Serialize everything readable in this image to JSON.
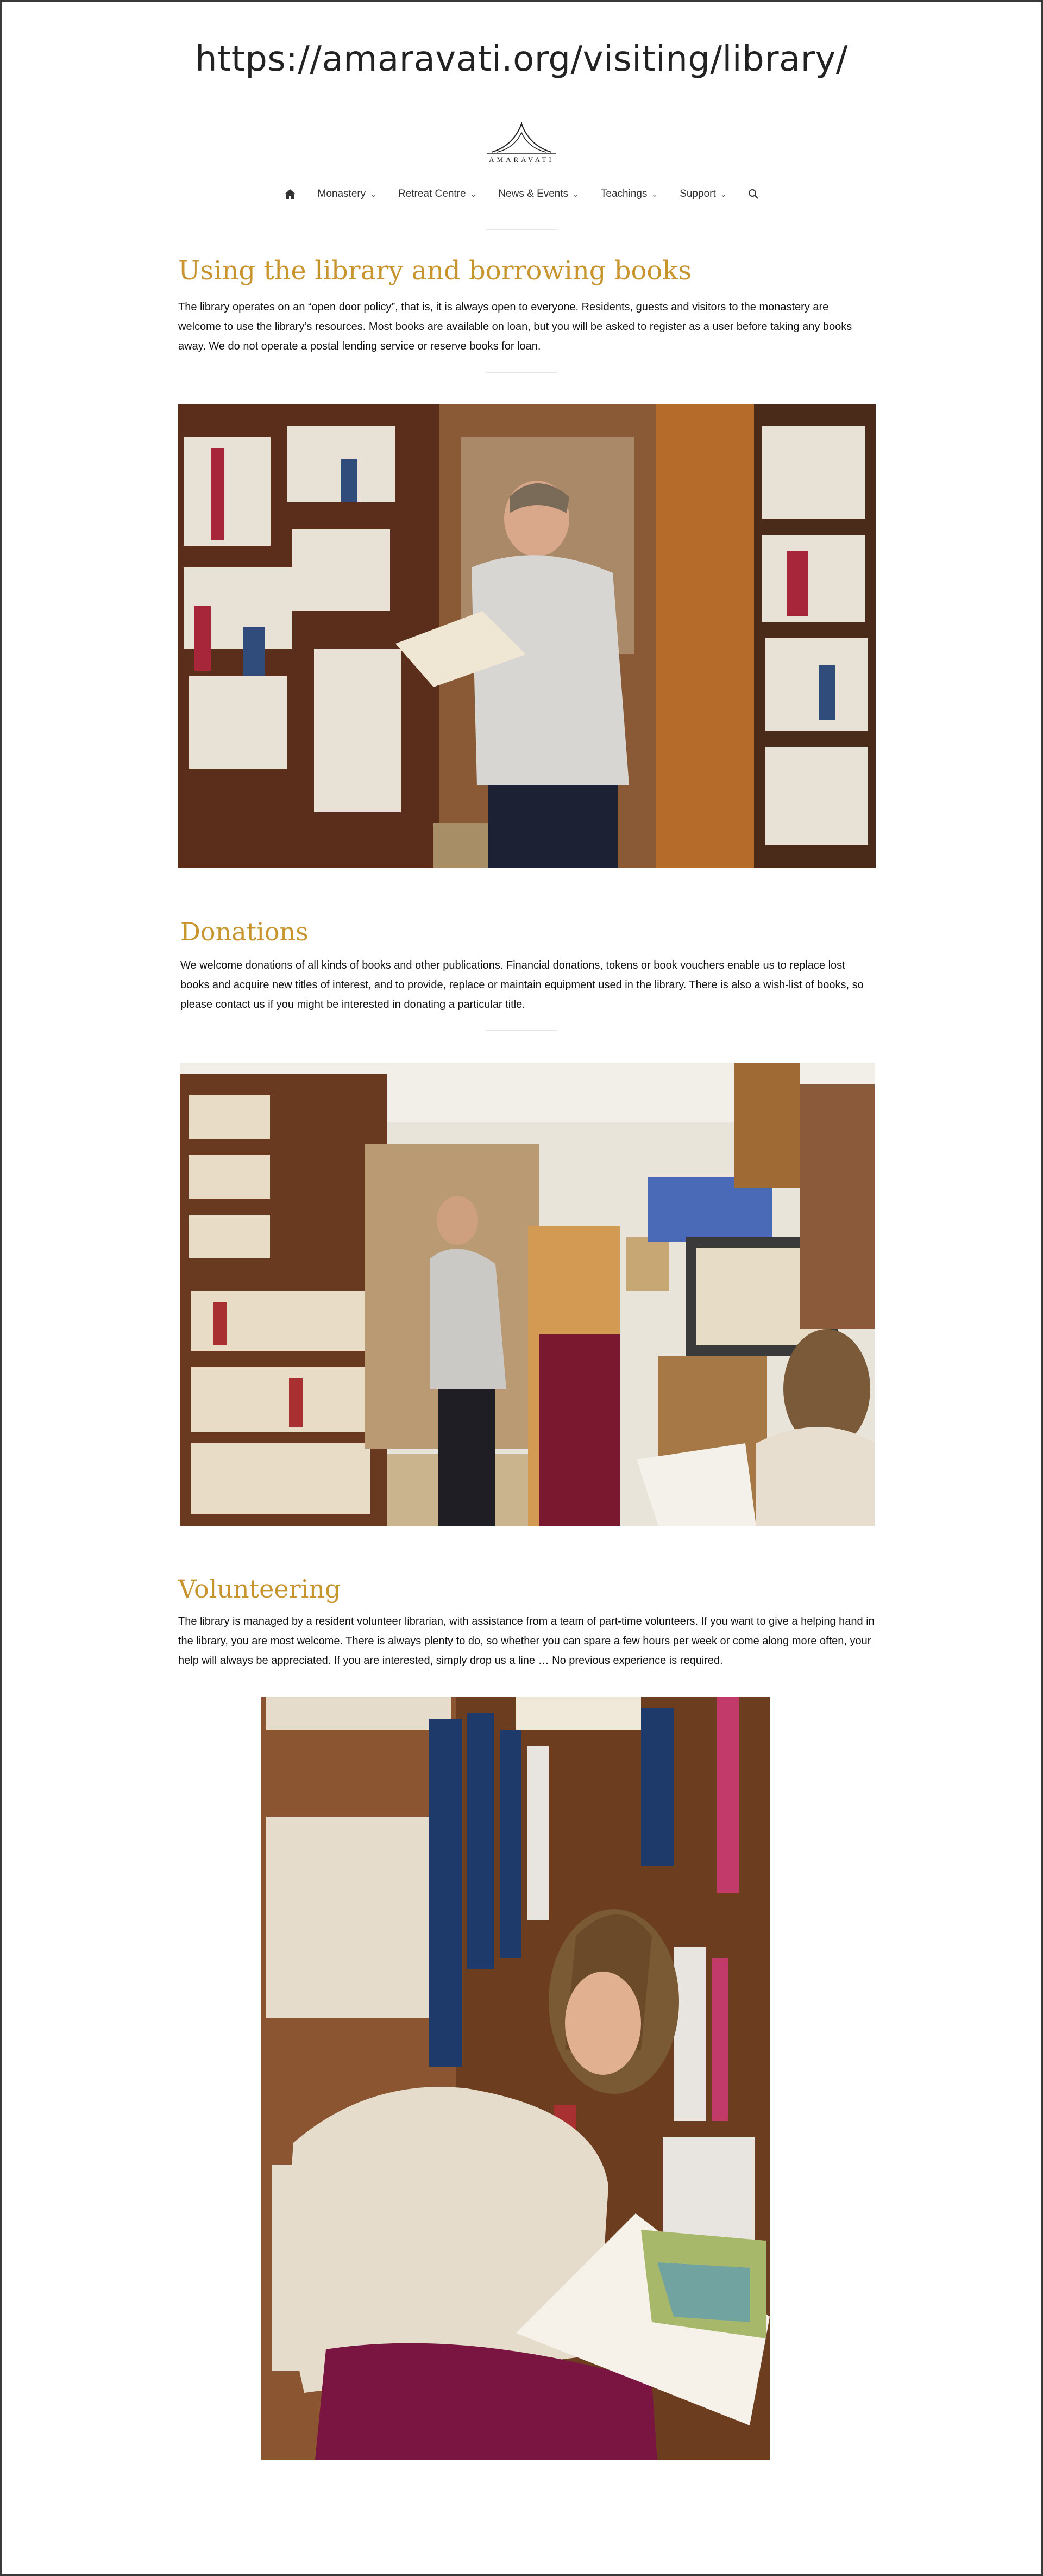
{
  "page": {
    "url_title": "https://amaravati.org/visiting/library/"
  },
  "brand": {
    "logo_text": "AMARAVATI"
  },
  "nav": {
    "items": [
      {
        "label": "Monastery"
      },
      {
        "label": "Retreat Centre"
      },
      {
        "label": "News & Events"
      },
      {
        "label": "Teachings"
      },
      {
        "label": "Support"
      }
    ],
    "home_icon": "home-icon",
    "search_icon": "search-icon"
  },
  "sections": {
    "borrowing": {
      "title": "Using the library and borrowing books",
      "text": "The library operates on an “open door policy”, that is, it is always open to everyone. Residents, guests and visitors to the monastery are welcome to use the library’s resources. Most books are available on loan, but you will be asked to register as a user before taking any books away. We do not operate a postal lending service or reserve books for loan."
    },
    "donations": {
      "title": "Donations",
      "text": "We welcome donations of all kinds of books and other publications. Financial donations, tokens or book vouchers enable us to replace lost books and acquire new titles of interest, and to provide, replace or maintain equipment used in the library. There is also a wish-list of books, so please contact us if you might be interested in donating a particular title."
    },
    "volunteering": {
      "title": "Volunteering",
      "text": "The library is managed by a resident volunteer librarian, with assistance from a team of part-time volunteers. If you want to give a helping hand in the library, you are most welcome. There is always plenty to do, so whether you can spare a few hours per week or come along more often, your help will always be appreciated. If you are interested, simply drop us a line … No previous experience is required."
    }
  },
  "colors": {
    "heading": "#c8942e",
    "text": "#111111",
    "rule": "#e5e5e5"
  }
}
